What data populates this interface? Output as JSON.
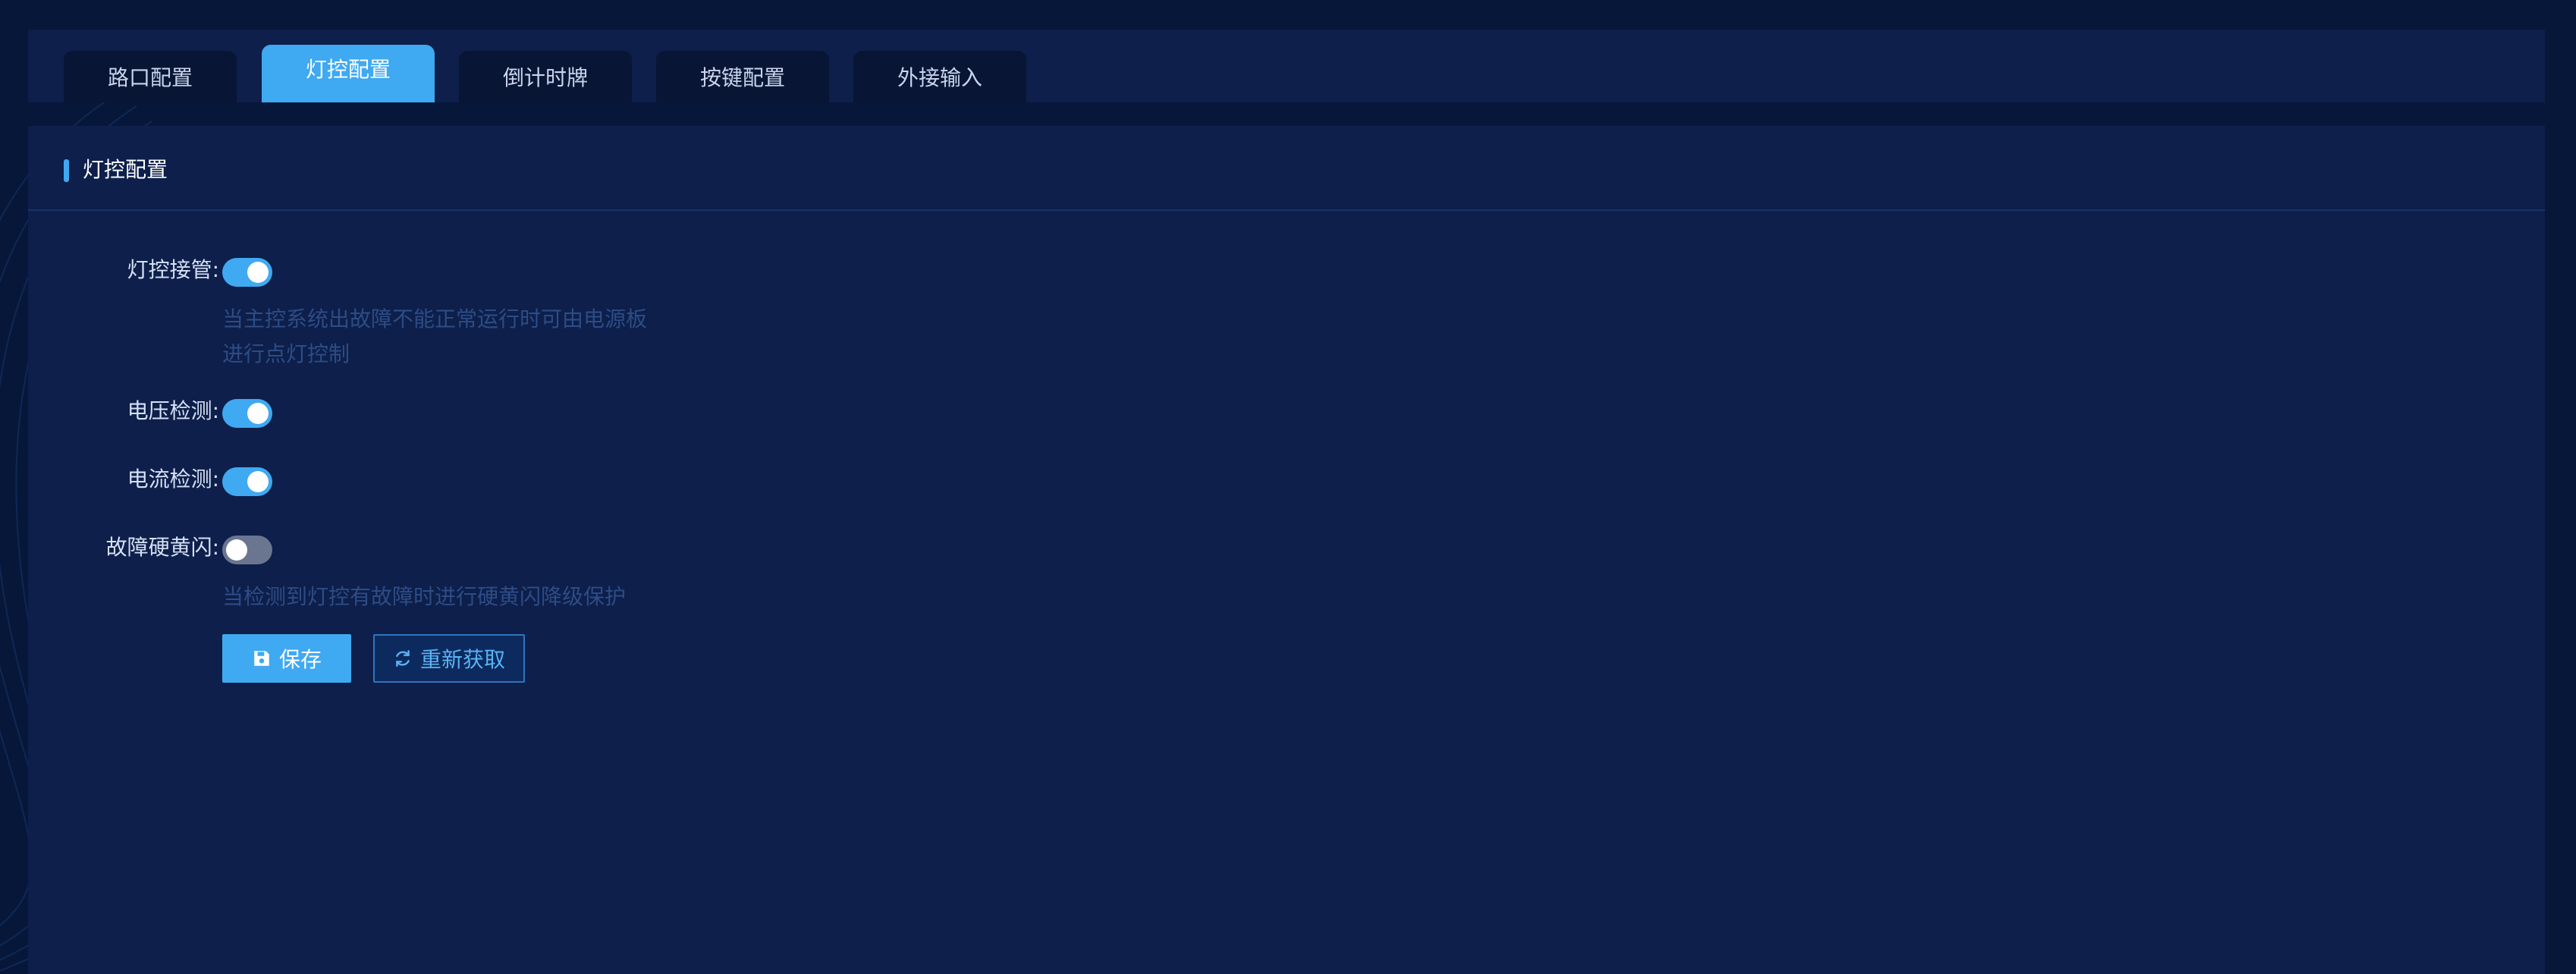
{
  "tabs": [
    {
      "label": "路口配置",
      "active": false
    },
    {
      "label": "灯控配置",
      "active": true
    },
    {
      "label": "倒计时牌",
      "active": false
    },
    {
      "label": "按键配置",
      "active": false
    },
    {
      "label": "外接输入",
      "active": false
    }
  ],
  "panel": {
    "title": "灯控配置"
  },
  "form": {
    "light_takeover": {
      "label": "灯控接管:",
      "enabled": true,
      "hint_line1": "当主控系统出故障不能正常运行时可由电源板",
      "hint_line2": "进行点灯控制"
    },
    "voltage_detect": {
      "label": "电压检测:",
      "enabled": true
    },
    "current_detect": {
      "label": "电流检测:",
      "enabled": true
    },
    "fault_yellow_flash": {
      "label": "故障硬黄闪:",
      "enabled": false,
      "hint": "当检测到灯控有故障时进行硬黄闪降级保护"
    }
  },
  "buttons": {
    "save_label": "保存",
    "refresh_label": "重新获取"
  },
  "colors": {
    "accent": "#3fa9f1",
    "background": "#071739",
    "panel": "#0d1f4a"
  }
}
